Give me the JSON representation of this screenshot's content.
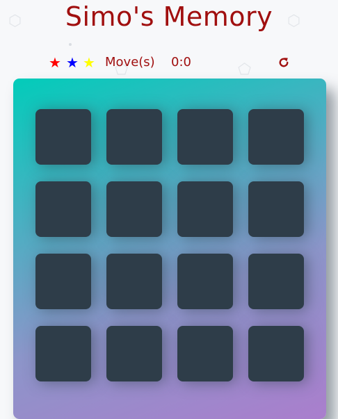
{
  "header": {
    "title": "Simo's Memory"
  },
  "score_panel": {
    "stars": [
      {
        "glyph": "★",
        "color": "#ff0000"
      },
      {
        "glyph": "★",
        "color": "#0000ff"
      },
      {
        "glyph": "★",
        "color": "#ffff00"
      }
    ],
    "moves_label": "Move(s)",
    "timer": "0:0",
    "restart_icon": "restart-icon"
  },
  "deck": {
    "rows": 4,
    "columns": 4,
    "card_state": "face-down"
  },
  "colors": {
    "title": "#a00f0f",
    "card_back": "#2e3d49",
    "deck_gradient_start": "#02ccba",
    "deck_gradient_end": "#aa7ecd"
  }
}
